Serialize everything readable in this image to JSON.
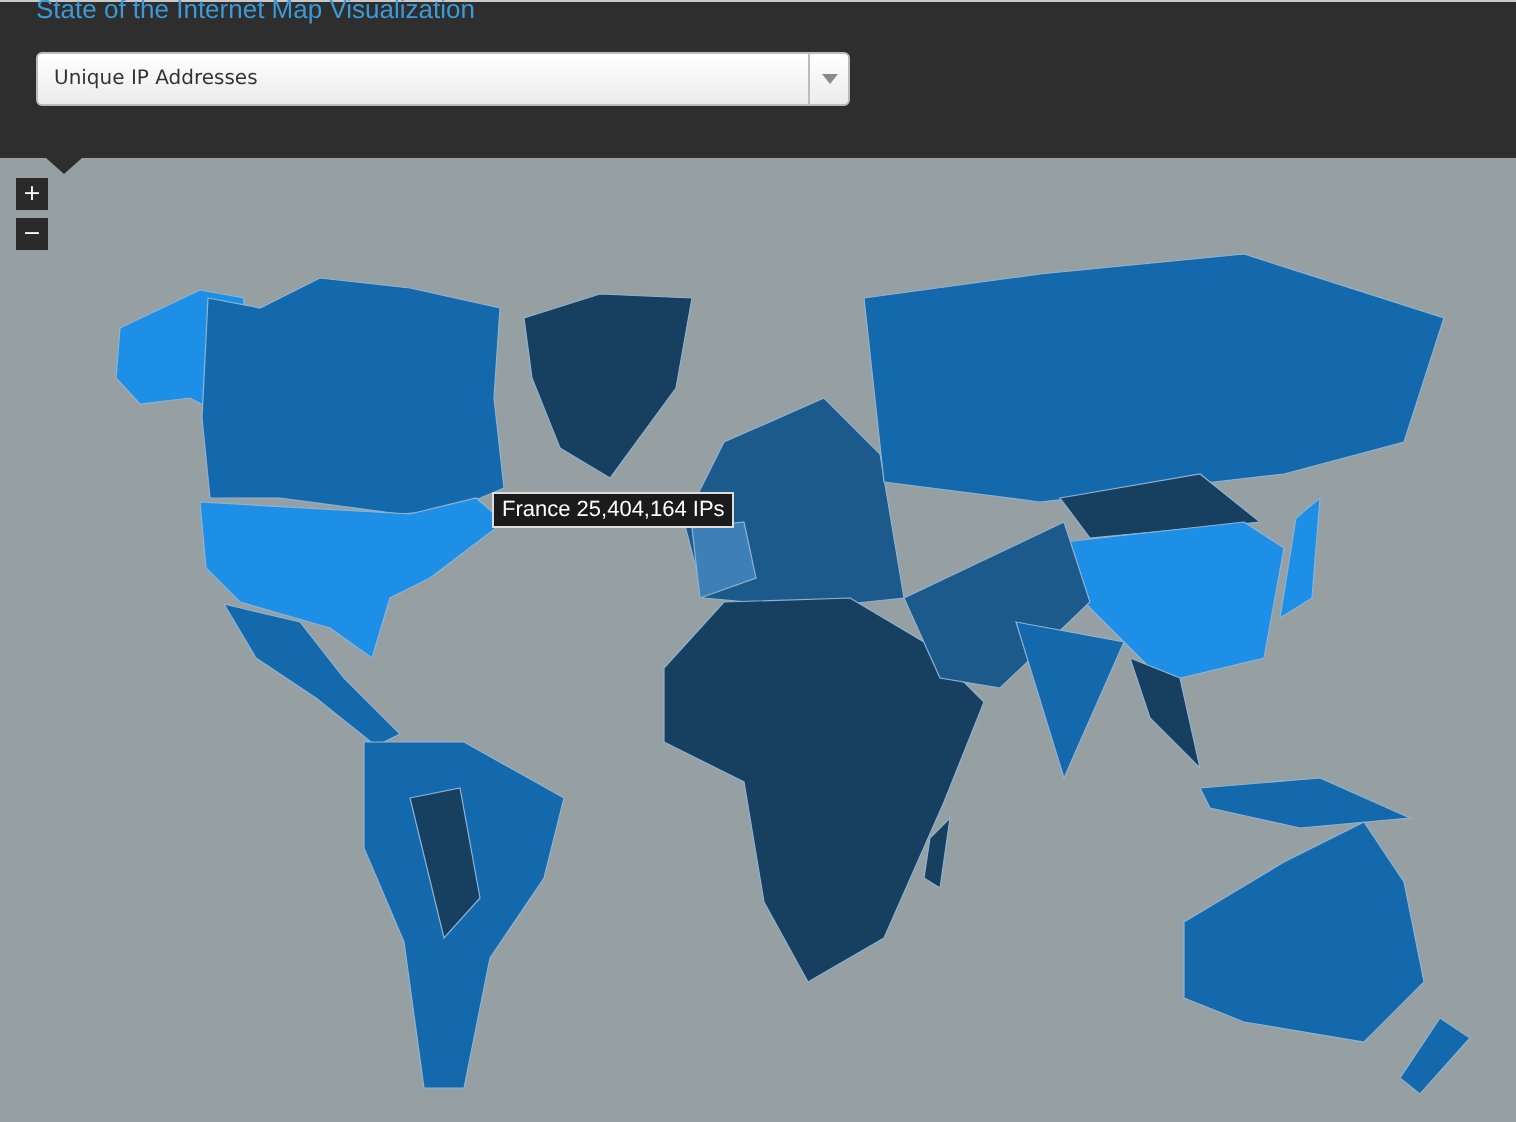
{
  "header": {
    "title": "State of the Internet Map Visualization"
  },
  "metric_select": {
    "value": "Unique IP Addresses"
  },
  "zoom_controls": [
    {
      "label": "+"
    },
    {
      "label": "−"
    }
  ],
  "tooltip": {
    "country": "France",
    "reading": "25,404,164 IPs"
  }
}
